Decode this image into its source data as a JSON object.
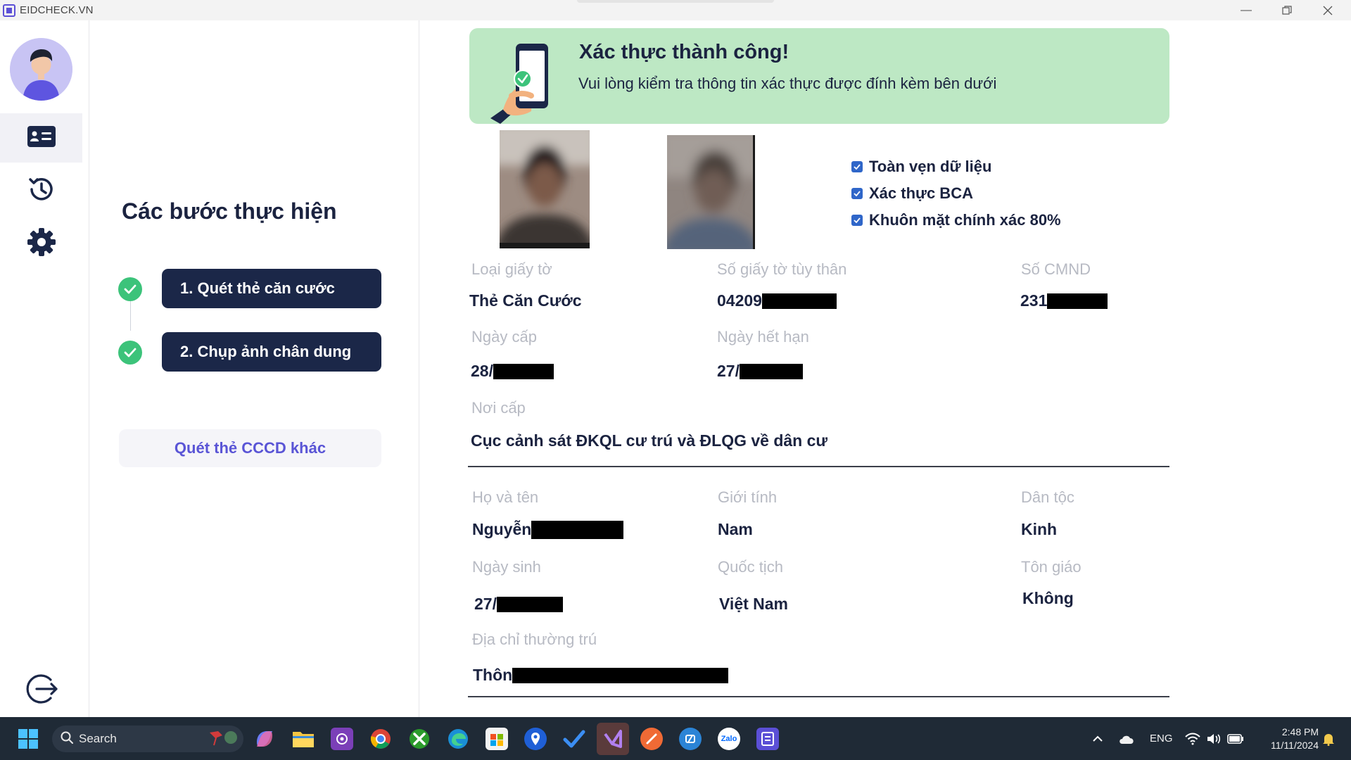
{
  "window": {
    "title": "EIDCHECK.VN",
    "controls": [
      "minimize",
      "restore",
      "close"
    ]
  },
  "sidebar": {
    "items": [
      {
        "name": "id-card",
        "active": true
      },
      {
        "name": "history",
        "active": false
      },
      {
        "name": "settings",
        "active": false
      }
    ],
    "logout_icon": "logout-icon"
  },
  "steps": {
    "title": "Các bước thực hiện",
    "items": [
      {
        "label": "1. Quét thẻ căn cước",
        "done": true
      },
      {
        "label": "2. Chụp ảnh chân dung",
        "done": true
      }
    ],
    "rescan_label": "Quét thẻ CCCD khác"
  },
  "banner": {
    "title": "Xác thực thành công!",
    "subtitle": "Vui lòng kiểm tra thông tin xác thực được đính kèm bên dưới"
  },
  "checks": [
    {
      "label": "Toàn vẹn dữ liệu",
      "checked": true
    },
    {
      "label": "Xác thực BCA",
      "checked": true
    },
    {
      "label": "Khuôn mặt chính xác 80%",
      "checked": true
    }
  ],
  "card": {
    "doc_type": {
      "label": "Loại giấy tờ",
      "value": "Thẻ Căn Cước"
    },
    "id_number": {
      "label": "Số giấy tờ tùy thân",
      "value": "04209"
    },
    "cmnd": {
      "label": "Số CMND",
      "value": "231"
    },
    "issue_date": {
      "label": "Ngày cấp",
      "value": "28/"
    },
    "expiry_date": {
      "label": "Ngày hết hạn",
      "value": "27/"
    },
    "issue_place": {
      "label": "Nơi cấp",
      "value": "Cục cảnh sát ĐKQL cư trú và ĐLQG về dân cư"
    }
  },
  "person": {
    "full_name": {
      "label": "Họ và tên",
      "value": "Nguyễn"
    },
    "gender": {
      "label": "Giới tính",
      "value": "Nam"
    },
    "ethnicity": {
      "label": "Dân tộc",
      "value": "Kinh"
    },
    "dob": {
      "label": "Ngày sinh",
      "value": "27/"
    },
    "nationality": {
      "label": "Quốc tịch",
      "value": "Việt Nam"
    },
    "religion": {
      "label": "Tôn giáo",
      "value": "Không"
    },
    "address": {
      "label": "Địa chỉ thường trú",
      "value": "Thôn"
    }
  },
  "taskbar": {
    "search_placeholder": "Search",
    "language": "ENG",
    "time": "2:48 PM",
    "date": "11/11/2024",
    "zalo_label": "Zalo"
  },
  "colors": {
    "navy": "#1b2748",
    "success_green": "#3cc37a",
    "banner_bg": "#bde8c4",
    "accent_purple": "#5a55d6",
    "checkbox_blue": "#2f66c9"
  }
}
